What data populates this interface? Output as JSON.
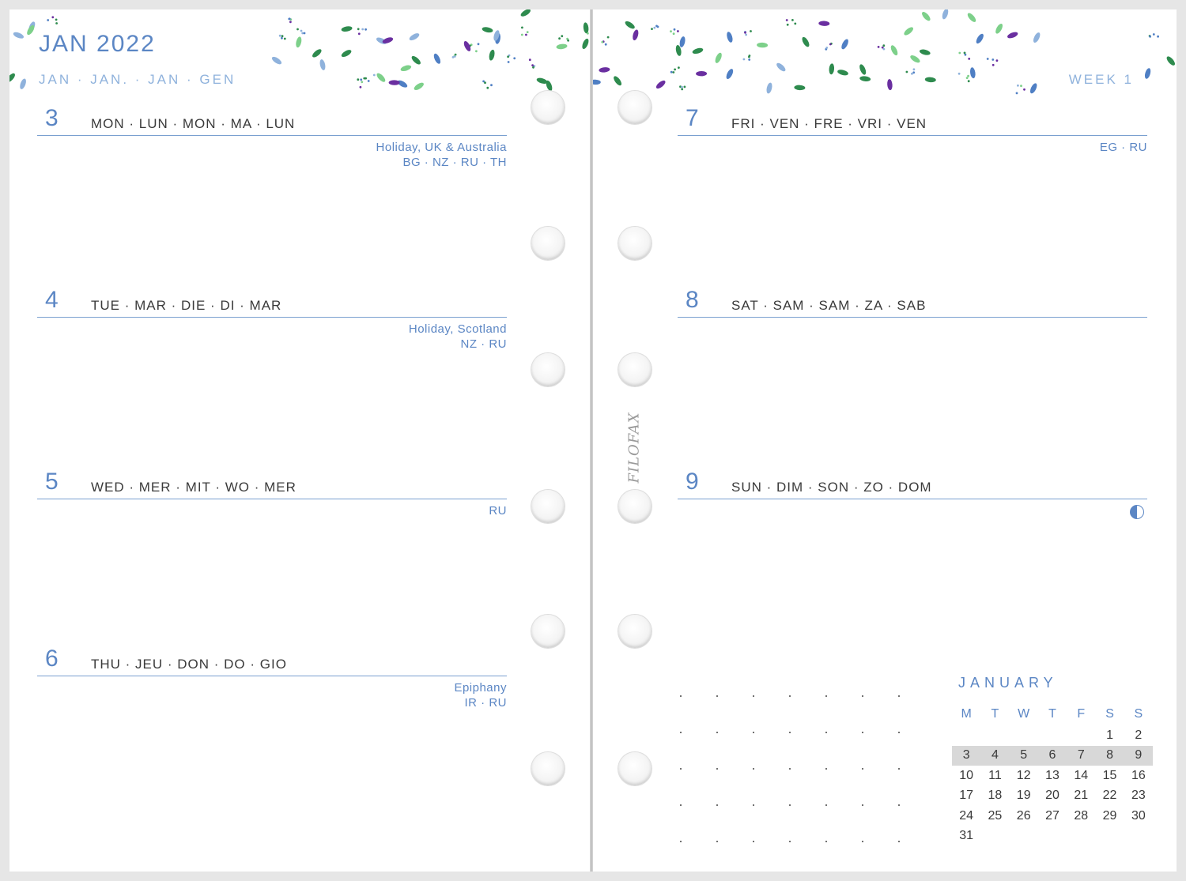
{
  "header": {
    "month_title": "JAN 2022",
    "month_translations": "JAN · JAN. · JAN · GEN",
    "week_label": "WEEK 1"
  },
  "left_days": [
    {
      "num": "3",
      "name": "MON · LUN · MON · MA · LUN",
      "notes": [
        "Holiday, UK & Australia",
        "BG · NZ · RU · TH"
      ]
    },
    {
      "num": "4",
      "name": "TUE · MAR · DIE · DI · MAR",
      "notes": [
        "Holiday, Scotland",
        "NZ · RU"
      ]
    },
    {
      "num": "5",
      "name": "WED · MER · MIT · WO · MER",
      "notes": [
        "RU"
      ]
    },
    {
      "num": "6",
      "name": "THU · JEU · DON · DO · GIO",
      "notes": [
        "Epiphany",
        "IR · RU"
      ]
    }
  ],
  "right_days": [
    {
      "num": "7",
      "name": "FRI · VEN · FRE · VRI · VEN",
      "notes": [
        "EG · RU"
      ]
    },
    {
      "num": "8",
      "name": "SAT · SAM · SAM · ZA · SAB",
      "notes": []
    },
    {
      "num": "9",
      "name": "SUN · DIM · SON · ZO · DOM",
      "notes": [],
      "moon_icon": "first-quarter-moon-icon"
    }
  ],
  "brand": "FILOFAX",
  "mini_calendar": {
    "title": "JANUARY",
    "weekday_headers": [
      "M",
      "T",
      "W",
      "T",
      "F",
      "S",
      "S"
    ],
    "weeks": [
      [
        "",
        "",
        "",
        "",
        "",
        "1",
        "2"
      ],
      [
        "3",
        "4",
        "5",
        "6",
        "7",
        "8",
        "9"
      ],
      [
        "10",
        "11",
        "12",
        "13",
        "14",
        "15",
        "16"
      ],
      [
        "17",
        "18",
        "19",
        "20",
        "21",
        "22",
        "23"
      ],
      [
        "24",
        "25",
        "26",
        "27",
        "28",
        "29",
        "30"
      ],
      [
        "31",
        "",
        "",
        "",
        "",
        "",
        ""
      ]
    ],
    "highlighted_week": 1
  },
  "colors": {
    "accent_blue": "#5b86c4",
    "light_blue": "#8fb2dc",
    "leaf_green": "#2e8b4e",
    "leaf_light_green": "#7dd08a",
    "leaf_purple": "#6a2fa0",
    "leaf_blue": "#4f7fc4"
  }
}
